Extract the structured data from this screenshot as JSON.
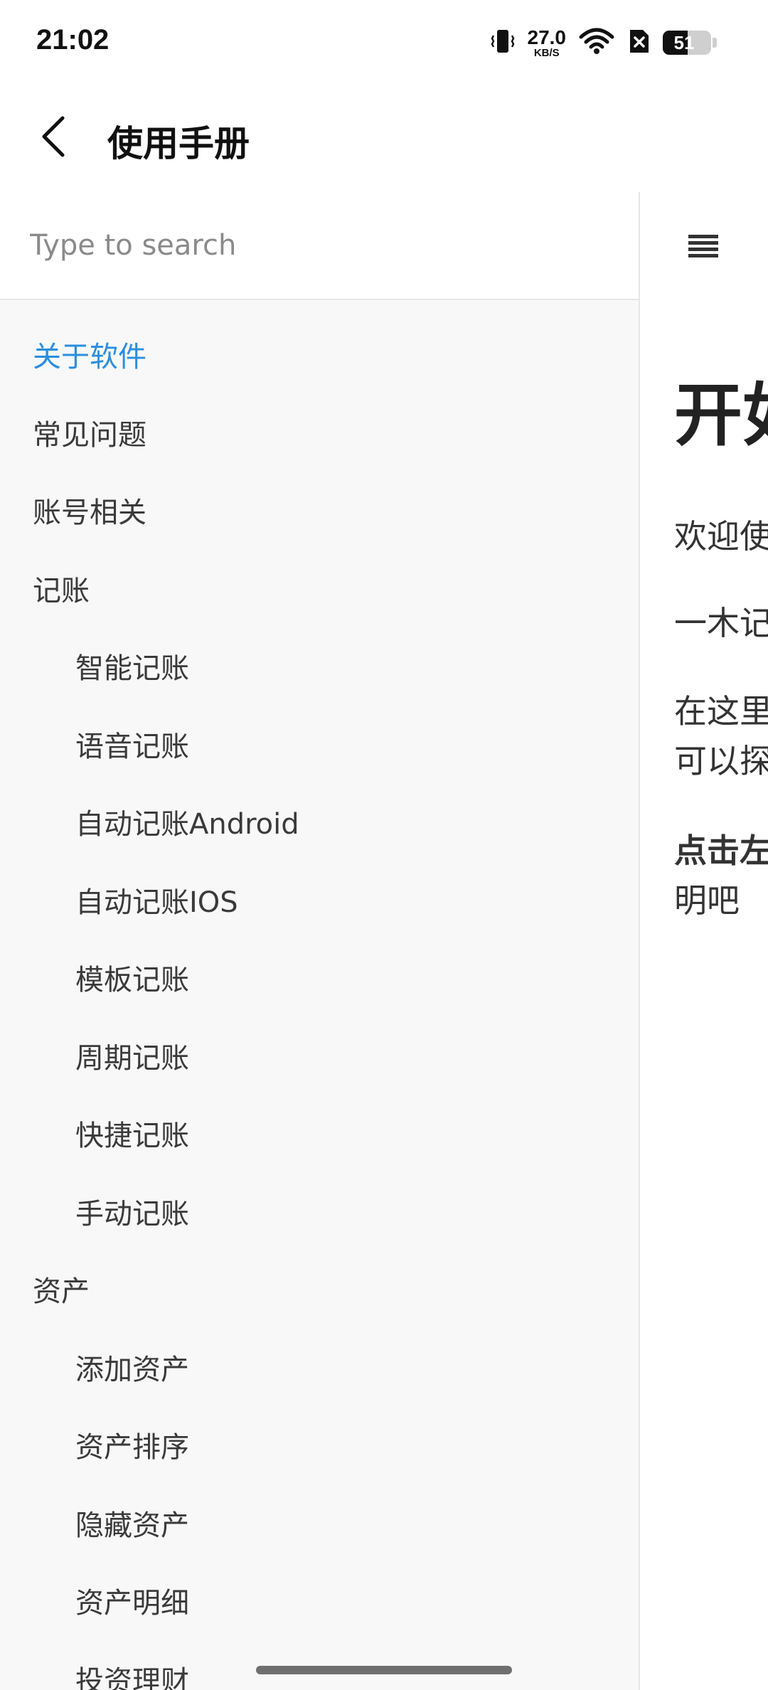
{
  "status_bar": {
    "time": "21:02",
    "net_speed_value": "27.0",
    "net_speed_unit": "KB/S",
    "battery_level": "51",
    "battery_fraction": 0.51,
    "icons": [
      "vibrate-icon",
      "wifi-icon",
      "sim-x-icon",
      "battery-icon"
    ]
  },
  "app_bar": {
    "title": "使用手册",
    "back_icon": "back-arrow-icon"
  },
  "search": {
    "placeholder": "Type to search",
    "value": ""
  },
  "sidebar": {
    "items": [
      {
        "label": "关于软件",
        "level": 0,
        "active": true
      },
      {
        "label": "常见问题",
        "level": 0,
        "active": false
      },
      {
        "label": "账号相关",
        "level": 0,
        "active": false
      },
      {
        "label": "记账",
        "level": 0,
        "active": false
      },
      {
        "label": "智能记账",
        "level": 1,
        "active": false
      },
      {
        "label": "语音记账",
        "level": 1,
        "active": false
      },
      {
        "label": "自动记账Android",
        "level": 1,
        "active": false
      },
      {
        "label": "自动记账IOS",
        "level": 1,
        "active": false
      },
      {
        "label": "模板记账",
        "level": 1,
        "active": false
      },
      {
        "label": "周期记账",
        "level": 1,
        "active": false
      },
      {
        "label": "快捷记账",
        "level": 1,
        "active": false
      },
      {
        "label": "手动记账",
        "level": 1,
        "active": false
      },
      {
        "label": "资产",
        "level": 0,
        "active": false
      },
      {
        "label": "添加资产",
        "level": 1,
        "active": false
      },
      {
        "label": "资产排序",
        "level": 1,
        "active": false
      },
      {
        "label": "隐藏资产",
        "level": 1,
        "active": false
      },
      {
        "label": "资产明细",
        "level": 1,
        "active": false
      },
      {
        "label": "投资理财",
        "level": 1,
        "active": false
      }
    ]
  },
  "content": {
    "menu_icon": "hamburger-menu-icon",
    "title": "开如",
    "paragraphs": [
      {
        "text": "欢迎使",
        "bold": false
      },
      {
        "text": "一木记",
        "bold": false
      },
      {
        "text": "在这里",
        "bold": false
      },
      {
        "text": "可以探",
        "bold": false
      },
      {
        "text": "点击左",
        "bold": true
      },
      {
        "text": "明吧",
        "bold": false
      }
    ]
  },
  "colors": {
    "accent": "#2a8ee0",
    "sidebar_bg": "#f8f8f8",
    "text": "#3a3a3a"
  }
}
